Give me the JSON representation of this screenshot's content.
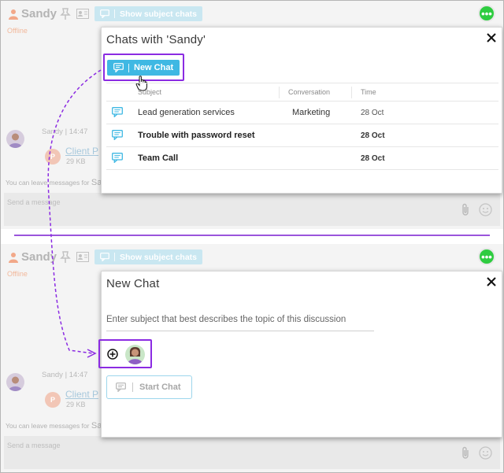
{
  "colors": {
    "accent": "#3fb8e3",
    "highlight": "#8b2be2",
    "status_online": "#2ecc40",
    "offline": "#f2b89b"
  },
  "background": {
    "contact_name": "Sandy",
    "subject_chats_label": "Show subject chats",
    "status": "Offline",
    "message": {
      "sender": "Sandy",
      "time": "14:47",
      "file_name": "Client P",
      "file_type_letter": "P",
      "file_size": "29 KB"
    },
    "leave_message_prefix": "You can leave messages for",
    "leave_message_name": "Sa",
    "input_placeholder": "Send a message",
    "icons": [
      "user-icon",
      "pin-icon",
      "contact-card-icon",
      "chat-bubble-icon",
      "more-dots-icon",
      "paperclip-icon",
      "emoji-icon"
    ]
  },
  "chats_dialog": {
    "title": "Chats with 'Sandy'",
    "new_chat_label": "New Chat",
    "columns": [
      "Subject",
      "Conversation",
      "Time"
    ],
    "rows": [
      {
        "subject": "Lead generation services",
        "conversation": "Marketing",
        "time": "28 Oct",
        "unread": false
      },
      {
        "subject": "Trouble with password reset",
        "conversation": "",
        "time": "28 Oct",
        "unread": true
      },
      {
        "subject": "Team Call",
        "conversation": "",
        "time": "28 Oct",
        "unread": true
      }
    ]
  },
  "new_chat_dialog": {
    "title": "New Chat",
    "subject_placeholder": "Enter subject that best describes the topic of this discussion",
    "start_chat_label": "Start Chat"
  }
}
